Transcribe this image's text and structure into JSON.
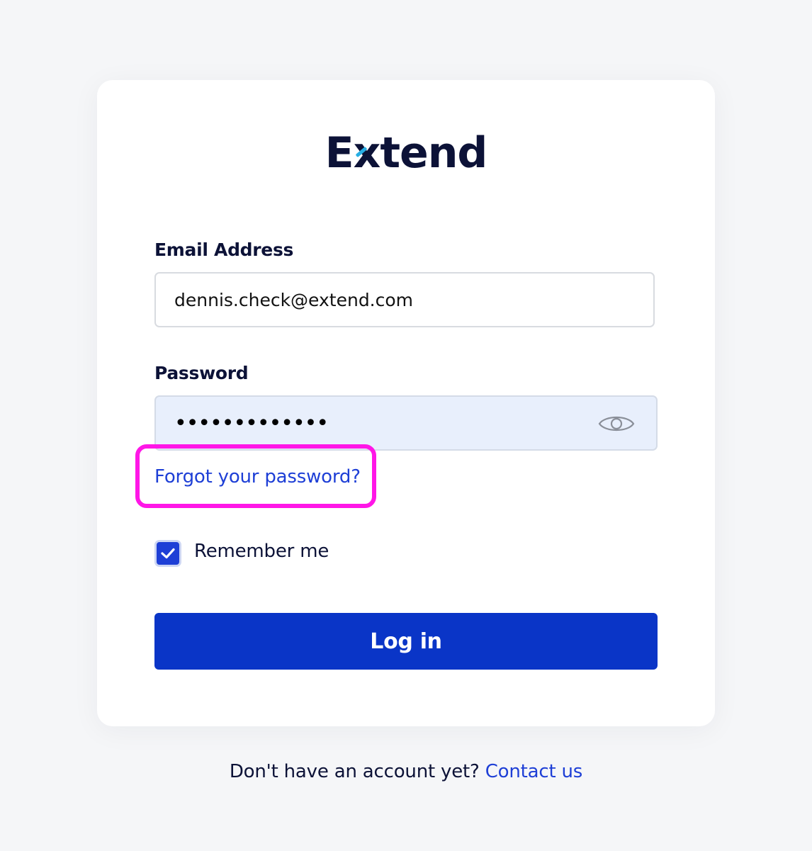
{
  "logo": {
    "brand_before": "E",
    "brand_x": "x",
    "brand_after": "tend",
    "accent_color": "#27aee4",
    "text_color": "#0c1237"
  },
  "form": {
    "email_label": "Email Address",
    "email_value": "dennis.check@extend.com",
    "password_label": "Password",
    "password_masked": "•••••••••••••",
    "show_password_icon": "eye-icon",
    "forgot_link": "Forgot your password?",
    "remember_label": "Remember me",
    "remember_checked": true,
    "submit_label": "Log in"
  },
  "footer": {
    "prompt": "Don't have an account yet?",
    "contact_link": "Contact us"
  },
  "colors": {
    "primary": "#0a35c7",
    "link": "#1e3fd6",
    "highlight_annotation": "#ff16e7",
    "password_field_bg": "#e8effc",
    "page_bg": "#f5f6f8"
  }
}
